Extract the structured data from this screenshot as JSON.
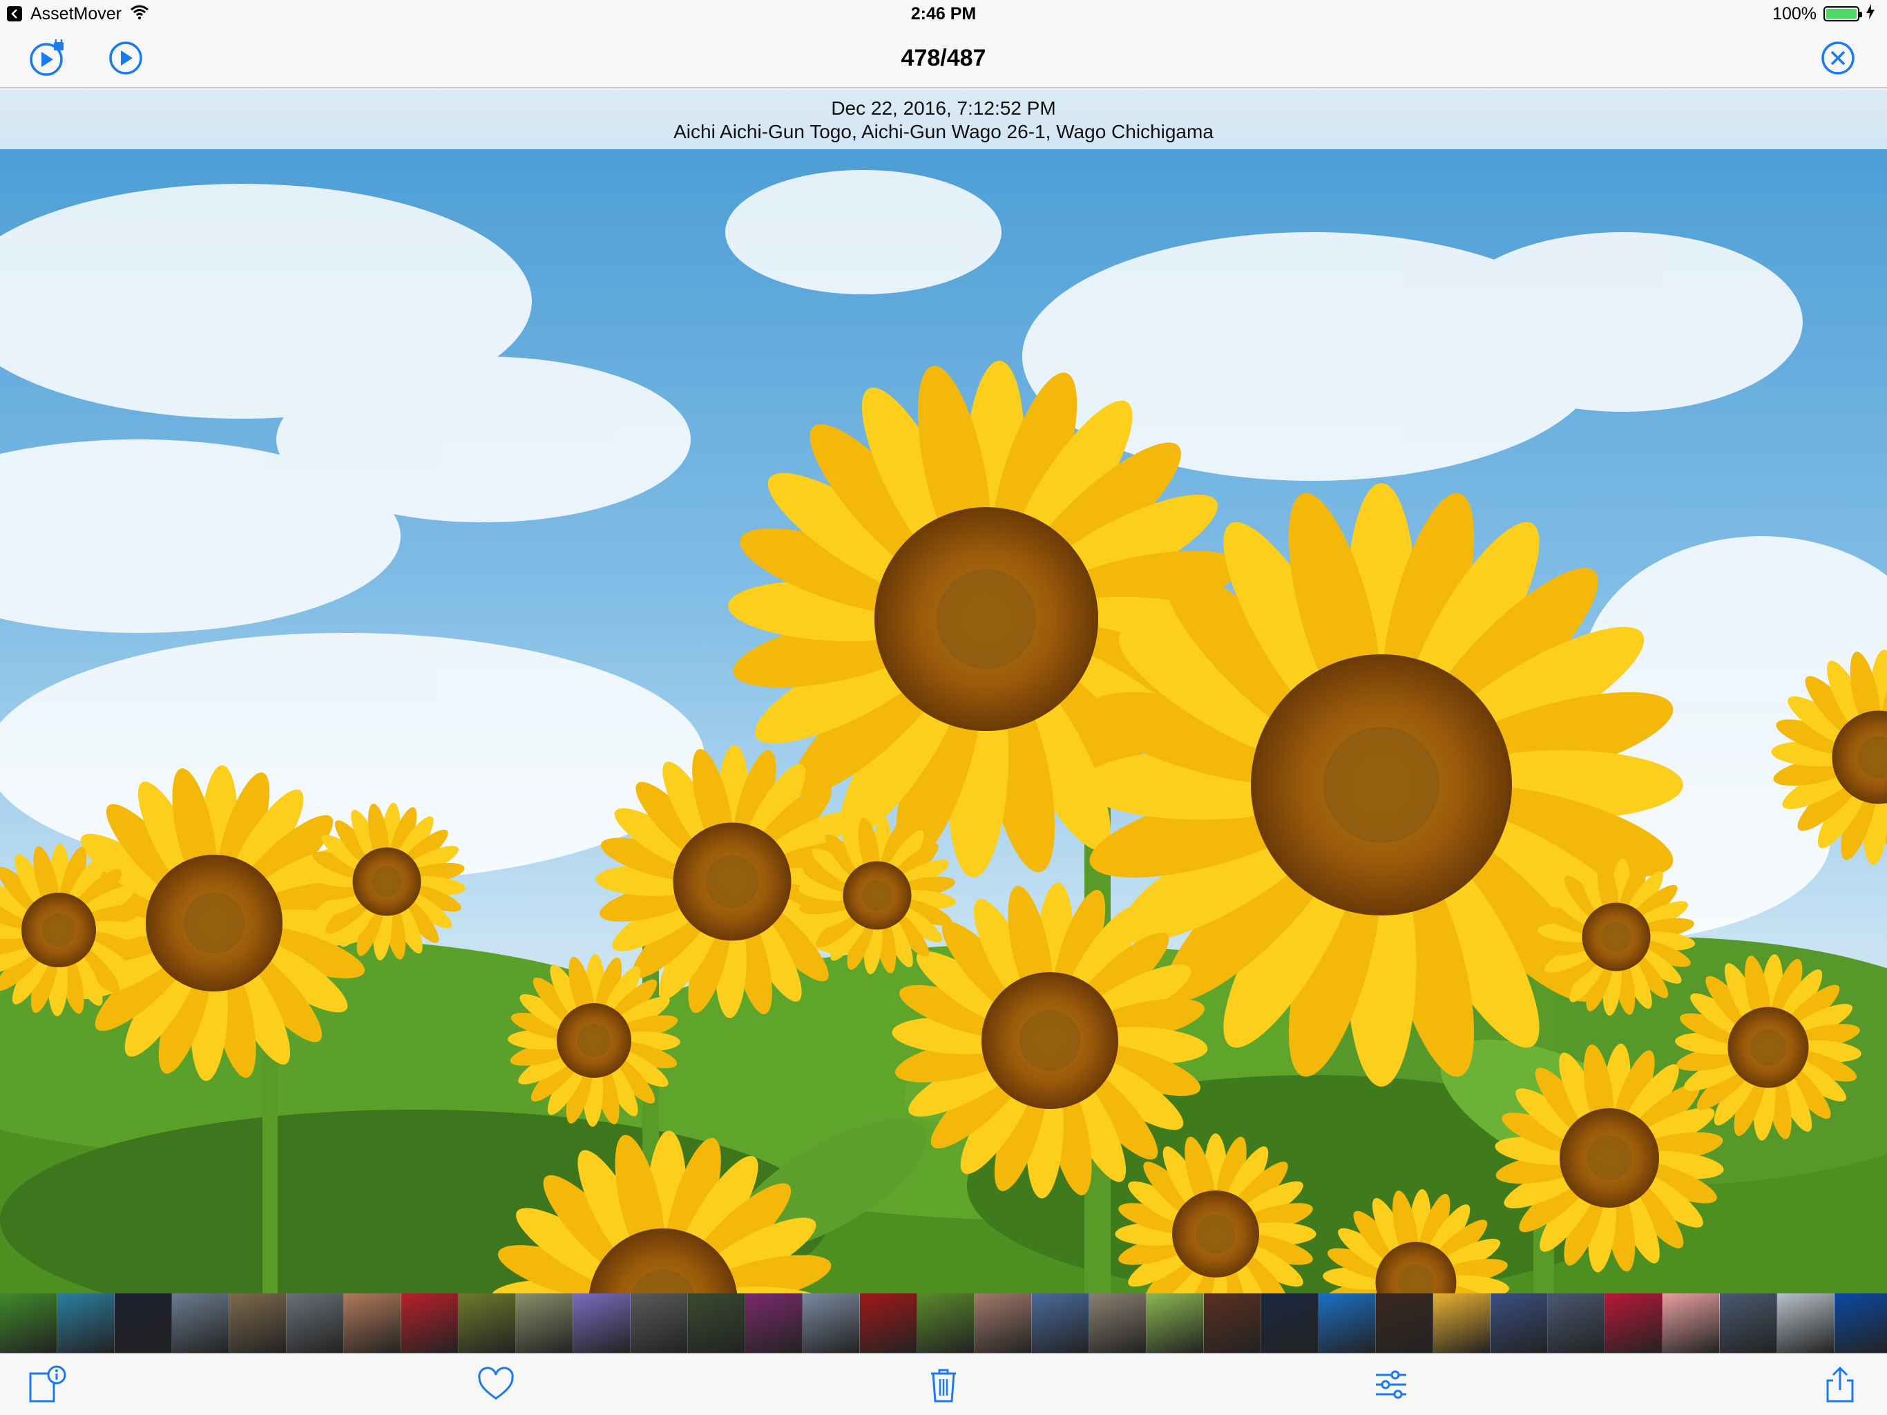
{
  "status_bar": {
    "app_name": "AssetMover",
    "time": "2:46 PM",
    "battery": "100%",
    "battery_level": 1.0
  },
  "nav": {
    "title": "478/487",
    "left_icons": [
      "slideshow-settings-icon",
      "play-icon"
    ],
    "right_icon": "close-icon"
  },
  "info": {
    "date": "Dec 22, 2016, 7:12:52 PM",
    "location": "Aichi Aichi-Gun Togo, Aichi-Gun Wago 26-1, Wago Chichigama"
  },
  "photo": {
    "subject": "sunflower-field-photo"
  },
  "thumbnails": {
    "count": 33,
    "colors": [
      "#3f8a2a",
      "#2a7fa0",
      "#1d2030",
      "#6b7b8e",
      "#7d6a4c",
      "#6a7076",
      "#b07a5a",
      "#b8202a",
      "#6f7a2a",
      "#8a8e6a",
      "#7a6cbf",
      "#5a5a5a",
      "#3a4a30",
      "#7a2a6a",
      "#7a8aa0",
      "#a01818",
      "#5a8a2a",
      "#a07a6a",
      "#4a6a9a",
      "#8a8070",
      "#8ab850",
      "#5a3020",
      "#1a2840",
      "#1a70c8",
      "#3a2820",
      "#e8b030",
      "#3a5080",
      "#4a5870",
      "#b81838",
      "#e8a0a0",
      "#4a5a70",
      "#b8c0c8",
      "#0a4aa0"
    ]
  },
  "toolbar": {
    "icons": [
      "info-icon",
      "heart-icon",
      "trash-icon",
      "sliders-icon",
      "share-icon"
    ]
  },
  "colors": {
    "tint": "#1a7af0",
    "bar_background": "#f7f7f7",
    "info_background": "#d6e8f4"
  }
}
